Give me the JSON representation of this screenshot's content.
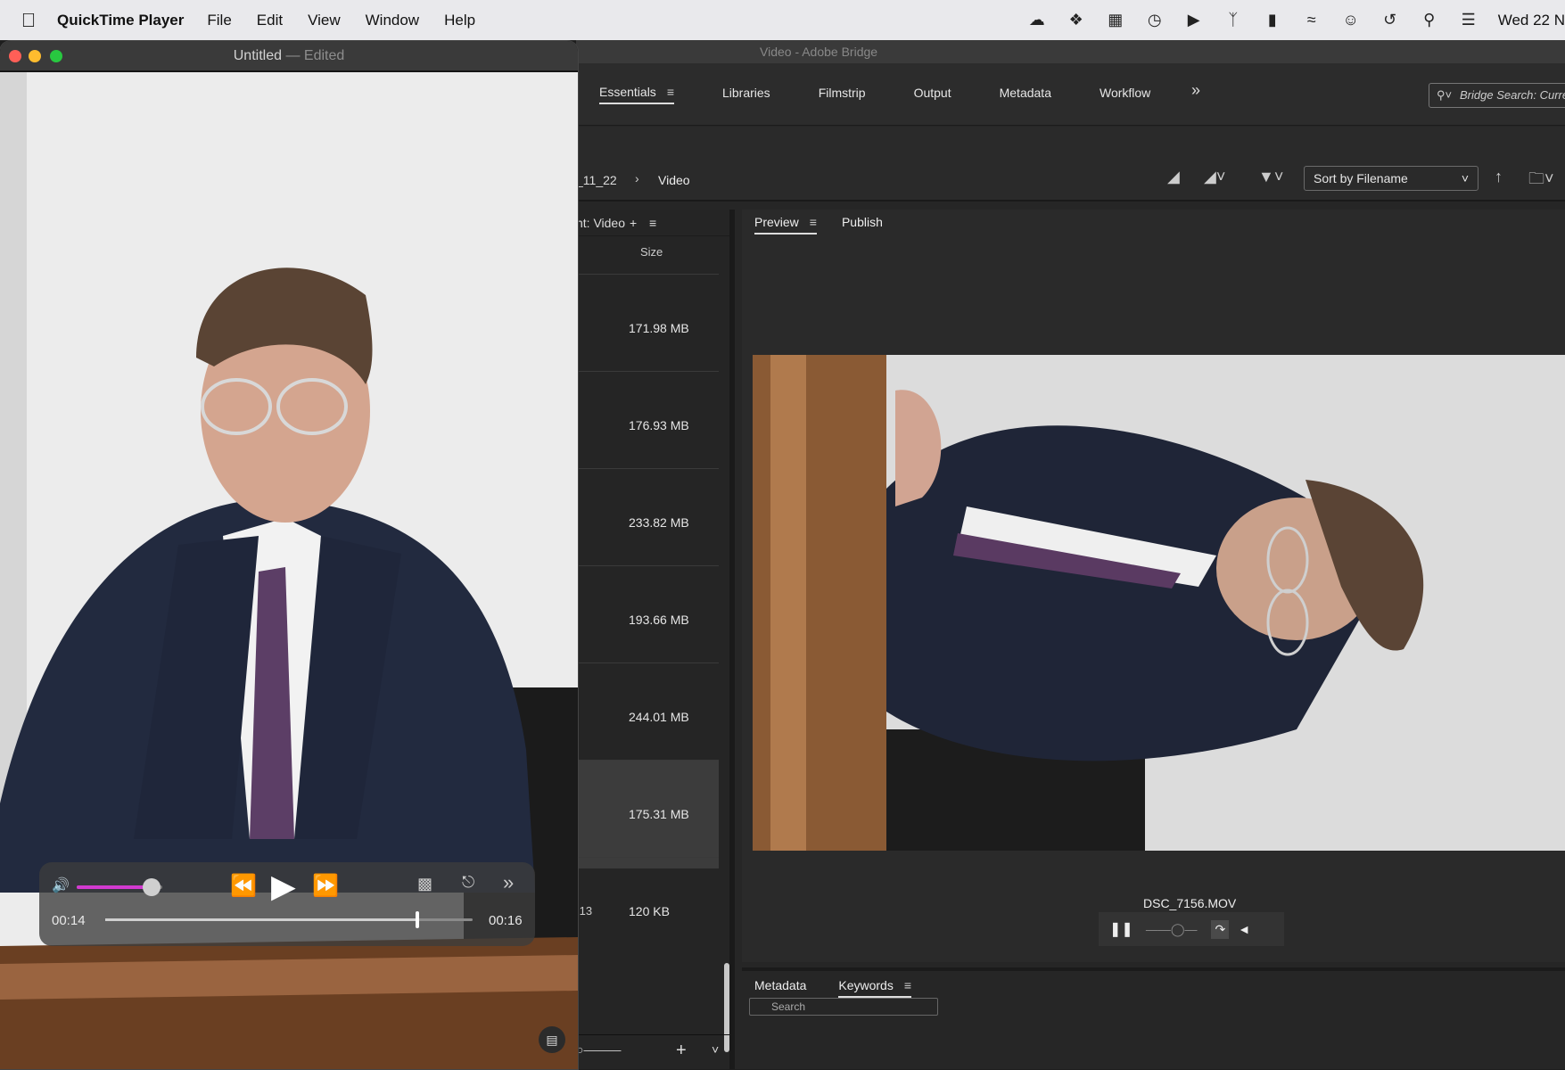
{
  "menubar": {
    "app_name": "QuickTime Player",
    "menus": [
      "File",
      "Edit",
      "View",
      "Window",
      "Help"
    ],
    "clock": "Wed 22 N"
  },
  "bridge": {
    "title": "Video - Adobe Bridge",
    "workspaces": [
      "Essentials",
      "Libraries",
      "Filmstrip",
      "Output",
      "Metadata",
      "Workflow"
    ],
    "search_placeholder": "Bridge Search: Curre",
    "breadcrumb": [
      "_11_22",
      "Video"
    ],
    "sort_label": "Sort by Filename",
    "content_tab": "nt: Video",
    "size_header": "Size",
    "sizes": [
      "171.98 MB",
      "176.93 MB",
      "233.82 MB",
      "193.66 MB",
      "244.01 MB",
      "175.31 MB",
      "120 KB"
    ],
    "last_row_date": ":13",
    "preview_tabs": [
      "Preview",
      "Publish"
    ],
    "preview_filename": "DSC_7156.MOV",
    "bottom_tabs": [
      "Metadata",
      "Keywords"
    ],
    "bottom_search": "Search"
  },
  "quicktime": {
    "title": "Untitled",
    "title_sep": "—",
    "edited": "Edited",
    "current_time": "00:14",
    "total_time": "00:16",
    "volume_level": 0.88,
    "progress": 0.85
  }
}
